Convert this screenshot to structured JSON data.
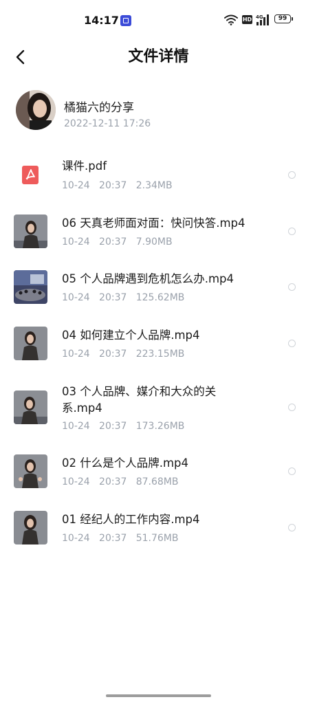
{
  "status_bar": {
    "time": "14:17",
    "hd_label": "HD",
    "network_label": "4G",
    "battery_level": "99"
  },
  "header": {
    "title": "文件详情",
    "back_icon": "chevron-left-icon"
  },
  "sharer": {
    "name": "橘猫六的分享",
    "date": "2022-12-11   17:26"
  },
  "files": [
    {
      "title": "课件.pdf",
      "meta": "10-24   20:37   2.34MB",
      "type": "pdf"
    },
    {
      "title": "06 天真老师面对面：快问快答.mp4",
      "meta": "10-24   20:37   7.90MB",
      "type": "video"
    },
    {
      "title": "05 个人品牌遇到危机怎么办.mp4",
      "meta": "10-24   20:37   125.62MB",
      "type": "video"
    },
    {
      "title": "04 如何建立个人品牌.mp4",
      "meta": "10-24   20:37   223.15MB",
      "type": "video"
    },
    {
      "title": "03 个人品牌、媒介和大众的关系.mp4",
      "meta": "10-24   20:37   173.26MB",
      "type": "video"
    },
    {
      "title": "02 什么是个人品牌.mp4",
      "meta": "10-24   20:37   87.68MB",
      "type": "video"
    },
    {
      "title": "01 经纪人的工作内容.mp4",
      "meta": "10-24   20:37   51.76MB",
      "type": "video"
    }
  ],
  "colors": {
    "meta_text": "#9aa1ab",
    "pdf_icon": "#ee5b5b",
    "notification_icon": "#3b4bd8"
  }
}
